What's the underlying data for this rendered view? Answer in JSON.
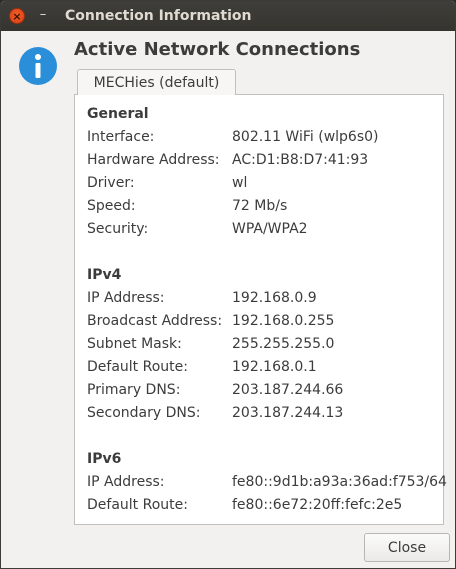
{
  "window": {
    "title": "Connection Information",
    "close_glyph": "×",
    "minimize_glyph": "–"
  },
  "heading": "Active Network Connections",
  "tab": {
    "label": "MECHies (default)"
  },
  "sections": [
    {
      "title": "General",
      "rows": [
        {
          "label": "Interface:",
          "value": "802.11 WiFi (wlp6s0)"
        },
        {
          "label": "Hardware Address:",
          "value": "AC:D1:B8:D7:41:93"
        },
        {
          "label": "Driver:",
          "value": "wl"
        },
        {
          "label": "Speed:",
          "value": "72 Mb/s"
        },
        {
          "label": "Security:",
          "value": "WPA/WPA2"
        }
      ]
    },
    {
      "title": "IPv4",
      "rows": [
        {
          "label": "IP Address:",
          "value": "192.168.0.9"
        },
        {
          "label": "Broadcast Address:",
          "value": "192.168.0.255"
        },
        {
          "label": "Subnet Mask:",
          "value": "255.255.255.0"
        },
        {
          "label": "Default Route:",
          "value": "192.168.0.1"
        },
        {
          "label": "Primary DNS:",
          "value": "203.187.244.66"
        },
        {
          "label": "Secondary DNS:",
          "value": "203.187.244.13"
        }
      ]
    },
    {
      "title": "IPv6",
      "rows": [
        {
          "label": "IP Address:",
          "value": "fe80::9d1b:a93a:36ad:f753/64"
        },
        {
          "label": "Default Route:",
          "value": "fe80::6e72:20ff:fefc:2e5"
        }
      ]
    }
  ],
  "buttons": {
    "close_label": "Close"
  },
  "icons": {
    "info": "info-icon",
    "window_close": "close-icon",
    "window_minimize": "minimize-icon"
  },
  "colors": {
    "info_blue": "#2a8fd8",
    "close_orange": "#e8501e",
    "titlebar": "#3c3b37"
  }
}
